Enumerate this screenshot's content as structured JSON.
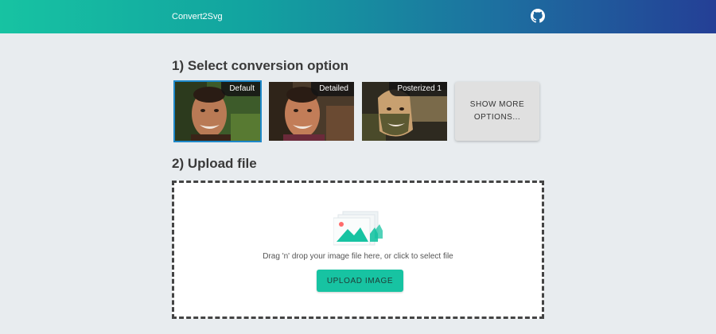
{
  "app": {
    "title": "Convert2Svg"
  },
  "header": {
    "github_icon": "github-icon"
  },
  "step1": {
    "title": "1) Select conversion option",
    "options": [
      {
        "label": "Default",
        "selected": true
      },
      {
        "label": "Detailed",
        "selected": false
      },
      {
        "label": "Posterized 1",
        "selected": false
      }
    ],
    "more_label": "SHOW MORE OPTIONS..."
  },
  "step2": {
    "title": "2) Upload file",
    "drop_text": "Drag 'n' drop your image file here, or click to select file",
    "upload_label": "UPLOAD IMAGE",
    "illustration_icon": "image-upload-icon"
  },
  "colors": {
    "accent": "#17c3a2",
    "header_start": "#17c3a2",
    "header_end": "#243f96",
    "selected_outline": "#1e88c9"
  }
}
